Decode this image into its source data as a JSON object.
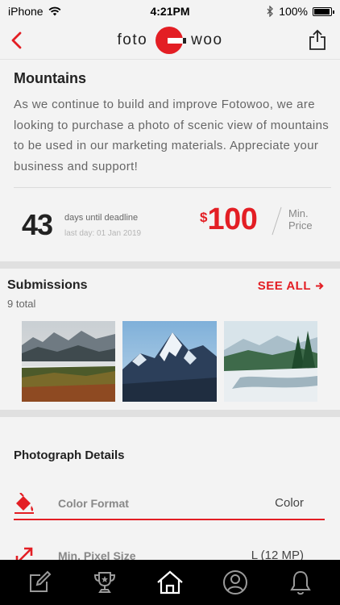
{
  "status_bar": {
    "carrier": "iPhone",
    "time": "4:21PM",
    "battery": "100%",
    "battery_level": 1.0,
    "icons": [
      "wifi-icon",
      "bluetooth-icon",
      "battery-icon"
    ]
  },
  "header": {
    "logo_left": "foto",
    "logo_right": "woo",
    "icons": [
      "back-icon",
      "share-icon"
    ],
    "accent_color": "#e31e24"
  },
  "request": {
    "title": "Mountains",
    "description": "As we continue to build and improve Fotowoo, we are looking to purchase a photo of scenic view of mountains to be used in our marketing materials. Appreciate your business and support!",
    "days_count": "43",
    "days_label": "days until deadline",
    "last_day": "last day: 01 Jan 2019",
    "price_currency": "$",
    "price_amount": "100",
    "price_label": "Min. Price"
  },
  "submissions": {
    "heading": "Submissions",
    "count": "9 total",
    "see_all": "SEE ALL",
    "thumbnails": [
      "mountain-valley-photo",
      "snowy-peak-photo",
      "winter-river-photo"
    ]
  },
  "details": {
    "heading": "Photograph Details",
    "rows": [
      {
        "label": "Color Format",
        "value": "Color",
        "icon": "paint-bucket-icon"
      },
      {
        "label": "Min. Pixel Size",
        "value": "L (12 MP)",
        "icon": "resize-icon"
      }
    ]
  },
  "tab_bar": {
    "tabs": [
      {
        "icon": "edit-icon",
        "active": false
      },
      {
        "icon": "trophy-icon",
        "active": false
      },
      {
        "icon": "home-icon",
        "active": true
      },
      {
        "icon": "profile-icon",
        "active": false
      },
      {
        "icon": "bell-icon",
        "active": false
      }
    ]
  }
}
